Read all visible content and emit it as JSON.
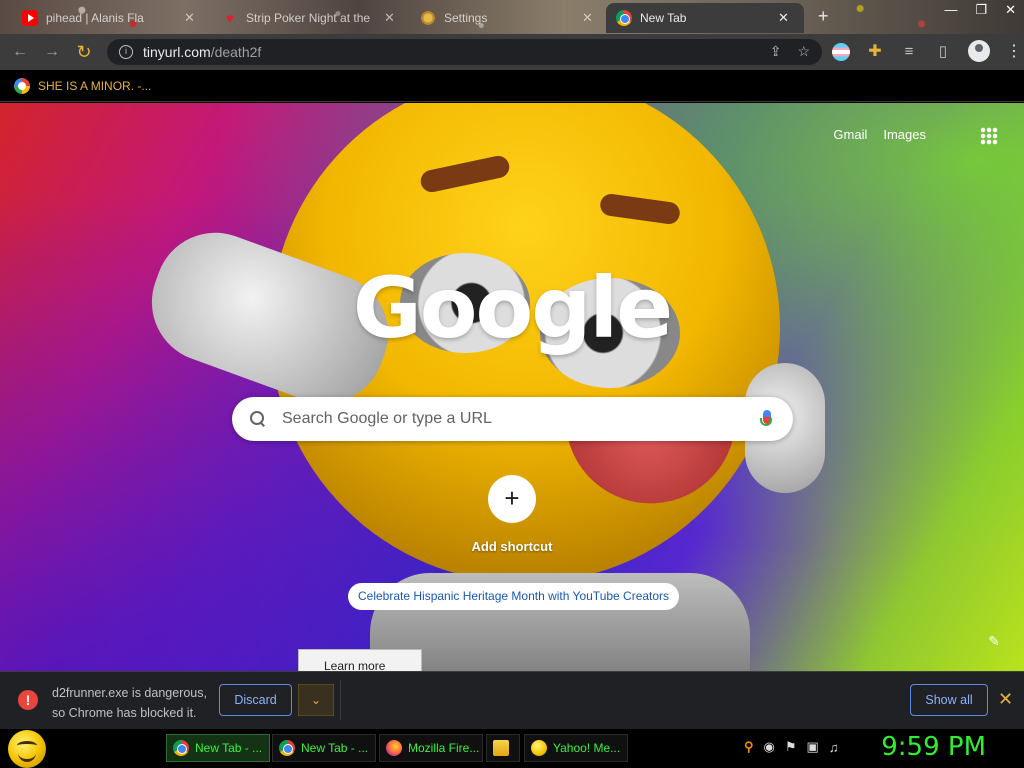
{
  "tabs": [
    {
      "title": "pihead | Alanis Fla",
      "icon": "youtube-icon",
      "active": false
    },
    {
      "title": "Strip Poker Night at the",
      "icon": "heart-icon",
      "active": false
    },
    {
      "title": "Settings",
      "icon": "settings-icon",
      "active": false
    },
    {
      "title": "New Tab",
      "icon": "chrome-icon",
      "active": true
    }
  ],
  "toolbar": {
    "url_host": "tinyurl.com",
    "url_path": "/death2f"
  },
  "bookmarks": [
    {
      "label": "SHE IS A MINOR. -...",
      "icon": "google-icon"
    }
  ],
  "ntp": {
    "top_links": [
      "Gmail",
      "Images"
    ],
    "logo": "Google",
    "search_placeholder": "Search Google or type a URL",
    "add_shortcut": "Add shortcut",
    "add_shortcut_glyph": "+",
    "promo": "Celebrate Hispanic Heritage Month with YouTube Creators",
    "learn_more": "Learn more"
  },
  "download": {
    "message_line1": "d2frunner.exe is dangerous,",
    "message_line2": "so Chrome has blocked it.",
    "discard": "Discard",
    "show_all": "Show all"
  },
  "taskbar": {
    "tasks": [
      {
        "label": "New Tab - ...",
        "icon": "chrome-icon",
        "active": true
      },
      {
        "label": "New Tab - ...",
        "icon": "chrome-icon",
        "active": false
      },
      {
        "label": "Mozilla Fire...",
        "icon": "firefox-icon",
        "active": false
      },
      {
        "label": "",
        "icon": "folder-icon",
        "active": false
      },
      {
        "label": "Yahoo! Me...",
        "icon": "yahoo-messenger-icon",
        "active": false
      }
    ],
    "clock": "9:59 PM"
  },
  "colors": {
    "accent_orange": "#e8b33c",
    "taskbar_green": "#2ef02e",
    "link_blue": "#8ab4f8",
    "danger_red": "#e8453c"
  }
}
